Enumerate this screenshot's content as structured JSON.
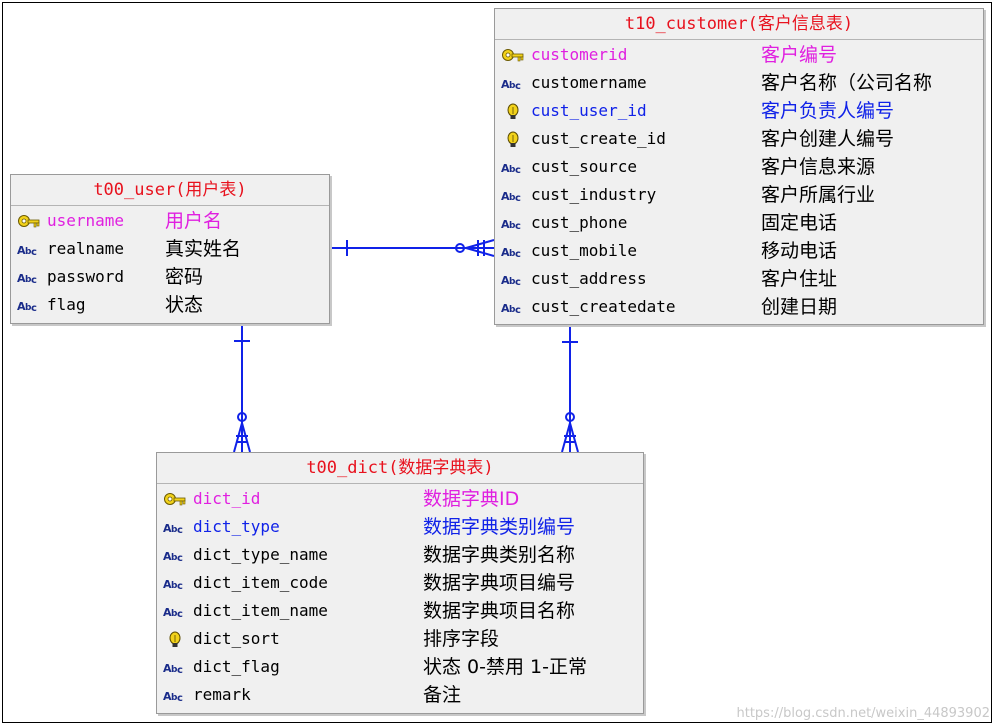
{
  "colors": {
    "pk": "#e020e0",
    "fk": "#1022e8",
    "normal": "#000000",
    "title": "#e8121e",
    "relation": "#1022e8"
  },
  "entities": [
    {
      "id": "customer",
      "title": "t10_customer(客户信息表)",
      "fields": [
        {
          "name": "customerid",
          "desc": "客户编号",
          "kind": "pk",
          "icon": "key-icon"
        },
        {
          "name": "customername",
          "desc": "客户名称（公司名称",
          "kind": "normal",
          "icon": "text-type-icon"
        },
        {
          "name": "cust_user_id",
          "desc": "客户负责人编号",
          "kind": "fk",
          "icon": "lightbulb-icon"
        },
        {
          "name": "cust_create_id",
          "desc": "客户创建人编号",
          "kind": "normal",
          "icon": "lightbulb-icon"
        },
        {
          "name": "cust_source",
          "desc": "客户信息来源",
          "kind": "normal",
          "icon": "text-type-icon"
        },
        {
          "name": "cust_industry",
          "desc": "客户所属行业",
          "kind": "normal",
          "icon": "text-type-icon"
        },
        {
          "name": "cust_phone",
          "desc": "固定电话",
          "kind": "normal",
          "icon": "text-type-icon"
        },
        {
          "name": "cust_mobile",
          "desc": "移动电话",
          "kind": "normal",
          "icon": "text-type-icon"
        },
        {
          "name": "cust_address",
          "desc": "客户住址",
          "kind": "normal",
          "icon": "text-type-icon"
        },
        {
          "name": "cust_createdate",
          "desc": "创建日期",
          "kind": "normal",
          "icon": "text-type-icon"
        }
      ]
    },
    {
      "id": "user",
      "title": "t00_user(用户表)",
      "fields": [
        {
          "name": "username",
          "desc": "用户名",
          "kind": "pk",
          "icon": "key-icon"
        },
        {
          "name": "realname",
          "desc": "真实姓名",
          "kind": "normal",
          "icon": "text-type-icon"
        },
        {
          "name": "password",
          "desc": "密码",
          "kind": "normal",
          "icon": "text-type-icon"
        },
        {
          "name": "flag",
          "desc": "状态",
          "kind": "normal",
          "icon": "text-type-icon"
        }
      ]
    },
    {
      "id": "dict",
      "title": "t00_dict(数据字典表)",
      "fields": [
        {
          "name": "dict_id",
          "desc": "数据字典ID",
          "kind": "pk",
          "icon": "key-icon"
        },
        {
          "name": "dict_type",
          "desc": "数据字典类别编号",
          "kind": "fk",
          "icon": "text-type-icon"
        },
        {
          "name": "dict_type_name",
          "desc": "数据字典类别名称",
          "kind": "normal",
          "icon": "text-type-icon"
        },
        {
          "name": "dict_item_code",
          "desc": "数据字典项目编号",
          "kind": "normal",
          "icon": "text-type-icon"
        },
        {
          "name": "dict_item_name",
          "desc": "数据字典项目名称",
          "kind": "normal",
          "icon": "text-type-icon"
        },
        {
          "name": "dict_sort",
          "desc": "排序字段",
          "kind": "normal",
          "icon": "lightbulb-icon"
        },
        {
          "name": "dict_flag",
          "desc": "状态 0-禁用 1-正常",
          "kind": "normal",
          "icon": "text-type-icon"
        },
        {
          "name": "remark",
          "desc": "备注",
          "kind": "normal",
          "icon": "text-type-icon"
        }
      ]
    }
  ],
  "relationships": [
    {
      "from": "user",
      "to": "customer",
      "notation": "one-to-zero-or-many"
    },
    {
      "from": "user",
      "to": "dict",
      "notation": "one-to-zero-or-many"
    },
    {
      "from": "customer",
      "to": "dict",
      "notation": "one-to-zero-or-many"
    }
  ],
  "watermark": "https://blog.csdn.net/weixin_44893902"
}
